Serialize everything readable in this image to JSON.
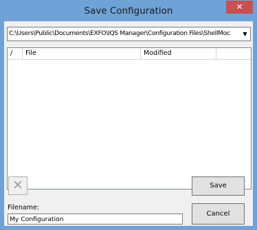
{
  "window": {
    "title": "Save Configuration",
    "close_glyph": "✕"
  },
  "path_combo": {
    "value": "C:\\Users\\Public\\Documents\\EXFO\\IQS Manager\\Configuration Files\\ShellMoc",
    "arrow_glyph": "▼"
  },
  "file_list": {
    "columns": {
      "sort": "/",
      "file": "File",
      "modified": "Modified",
      "extra": ""
    }
  },
  "delete_button": {
    "glyph": "✕"
  },
  "filename": {
    "label": "Filename:",
    "value": "My Configuration"
  },
  "buttons": {
    "save": "Save",
    "cancel": "Cancel"
  }
}
